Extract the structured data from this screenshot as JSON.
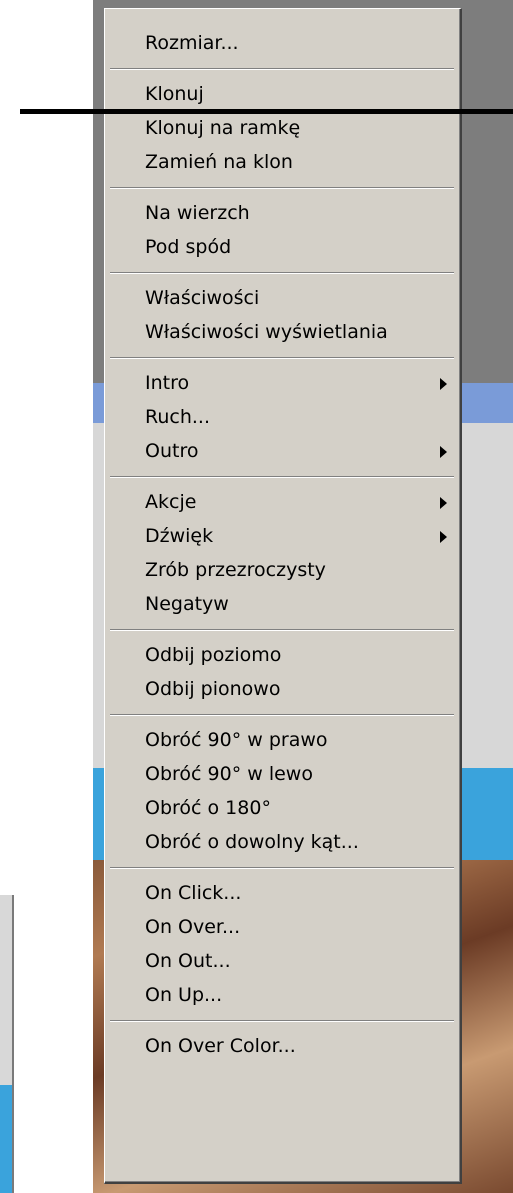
{
  "menu": {
    "groups": [
      {
        "items": [
          {
            "label": "Rozmiar..."
          }
        ]
      },
      {
        "items": [
          {
            "label": "Klonuj"
          },
          {
            "label": "Klonuj na ramkę"
          },
          {
            "label": "Zamień na klon"
          }
        ]
      },
      {
        "items": [
          {
            "label": "Na wierzch"
          },
          {
            "label": "Pod spód"
          }
        ]
      },
      {
        "items": [
          {
            "label": "Właściwości"
          },
          {
            "label": "Właściwości wyświetlania"
          }
        ]
      },
      {
        "items": [
          {
            "label": "Intro",
            "submenu": true
          },
          {
            "label": "Ruch..."
          },
          {
            "label": "Outro",
            "submenu": true
          }
        ]
      },
      {
        "items": [
          {
            "label": "Akcje",
            "submenu": true
          },
          {
            "label": "Dźwięk",
            "submenu": true
          },
          {
            "label": "Zrób przezroczysty"
          },
          {
            "label": "Negatyw"
          }
        ]
      },
      {
        "items": [
          {
            "label": "Odbij poziomo"
          },
          {
            "label": "Odbij pionowo"
          }
        ]
      },
      {
        "items": [
          {
            "label": "Obróć 90° w prawo"
          },
          {
            "label": "Obróć 90° w lewo"
          },
          {
            "label": "Obróć o 180°"
          },
          {
            "label": "Obróć o dowolny kąt..."
          }
        ]
      },
      {
        "items": [
          {
            "label": "On Click..."
          },
          {
            "label": "On Over..."
          },
          {
            "label": "On Out..."
          },
          {
            "label": "On Up..."
          }
        ]
      },
      {
        "items": [
          {
            "label": "On Over Color..."
          }
        ]
      }
    ]
  },
  "icons": {
    "submenu": "submenu-arrow-icon"
  },
  "colors": {
    "menu_bg": "#d4d0c8",
    "text": "#000000"
  }
}
